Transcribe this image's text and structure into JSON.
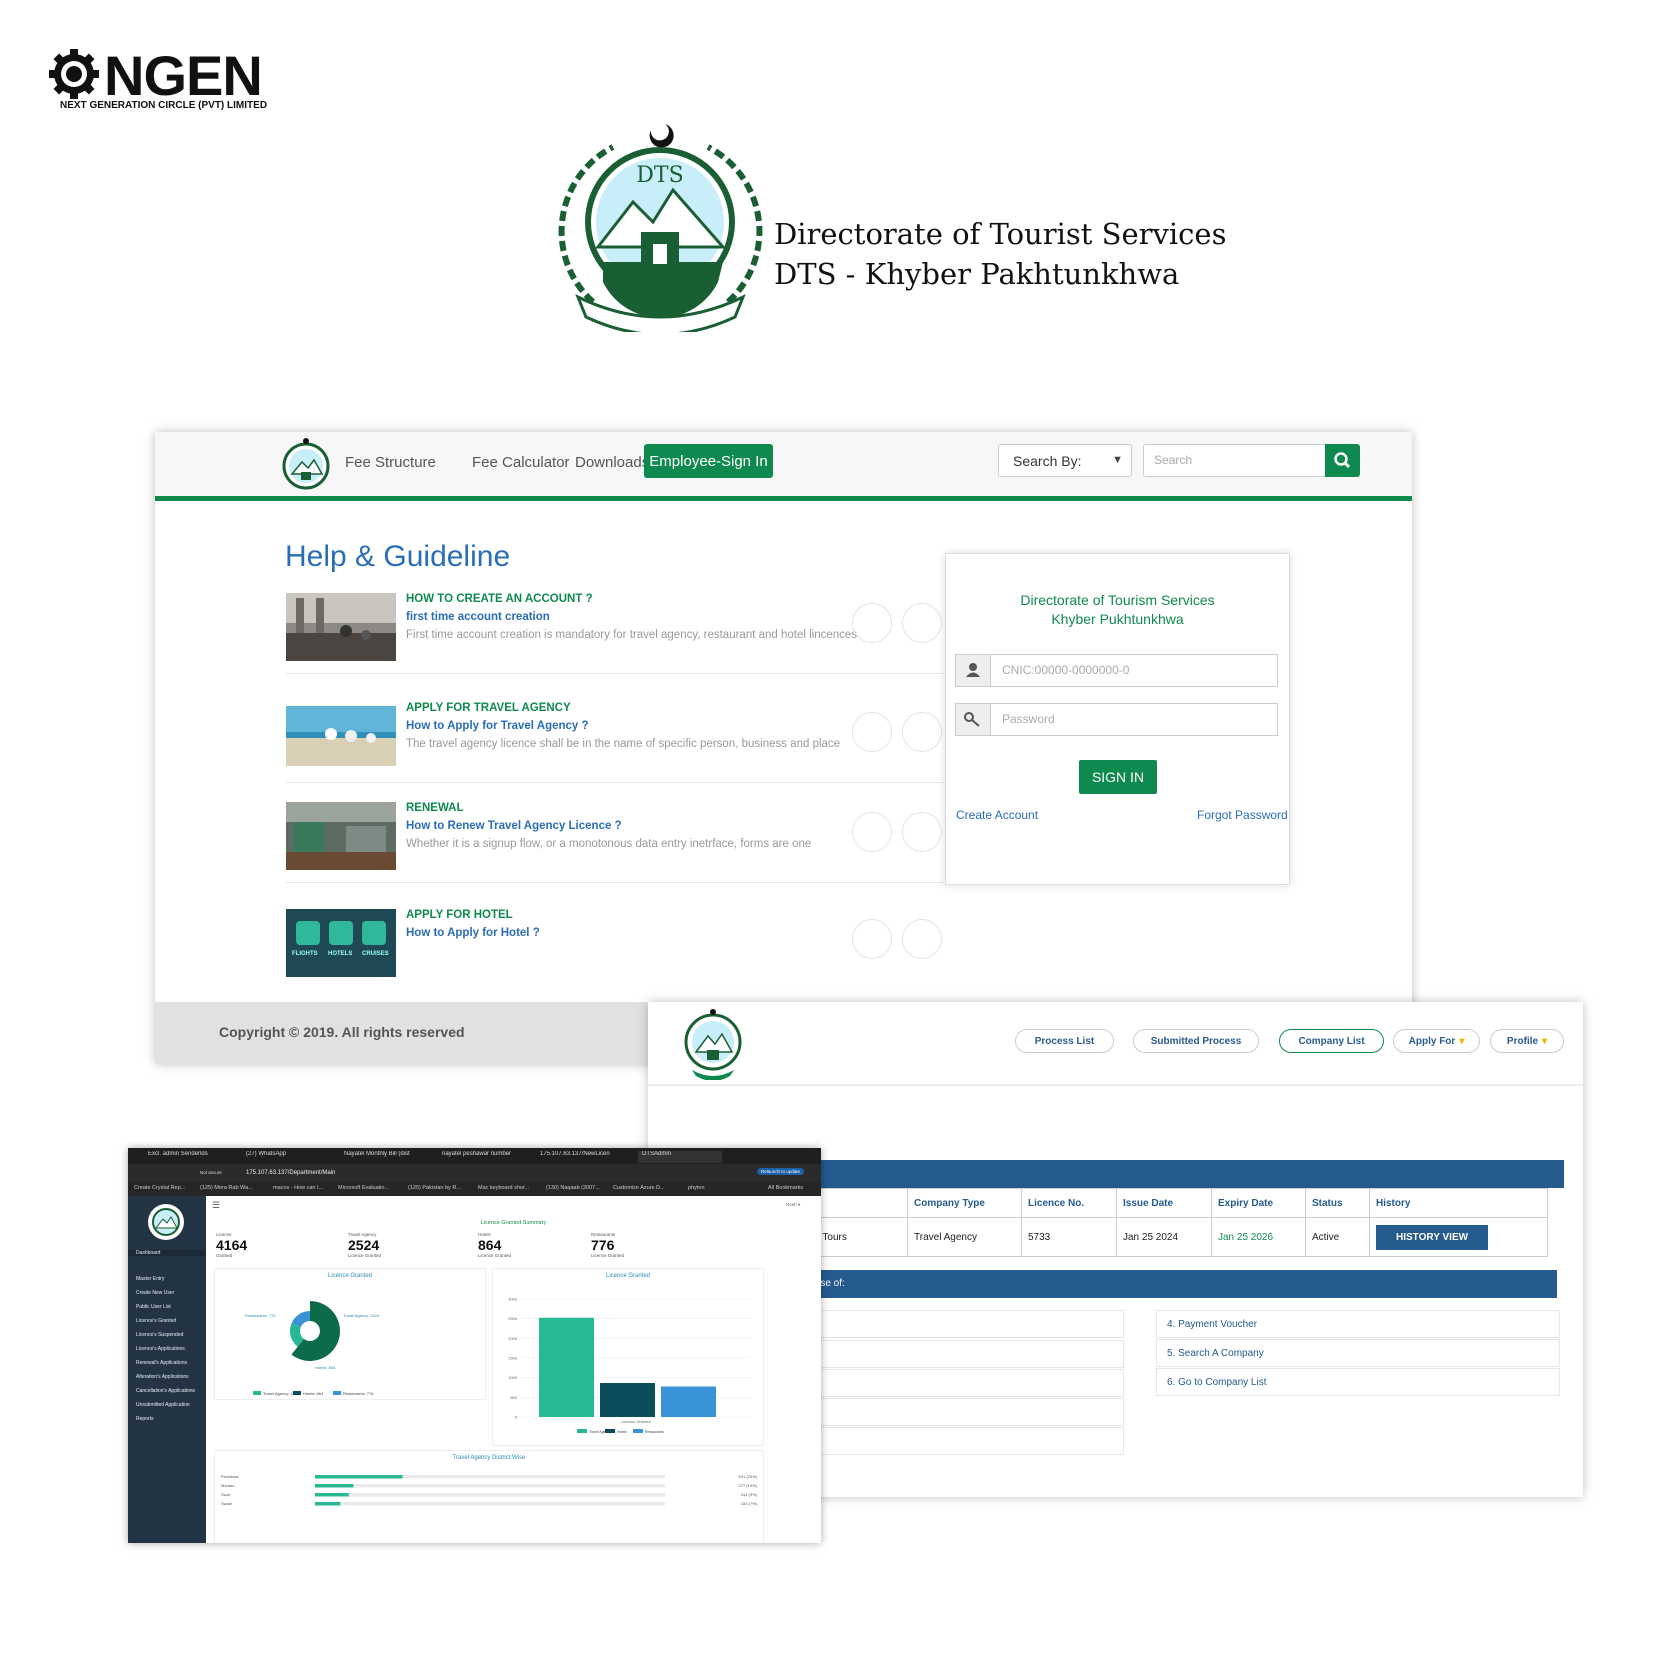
{
  "brand": {
    "name": "NGEN",
    "tagline": "NEXT GENERATION CIRCLE (PVT) LIMITED"
  },
  "dts": {
    "emblem_text": "DTS",
    "line1": "Directorate of Tourist Services",
    "line2": "DTS - Khyber Pakhtunkhwa"
  },
  "login_page": {
    "nav": {
      "links": [
        "Fee Structure",
        "Fee Calculator",
        "Downloads"
      ],
      "employee_sign_in": "Employee-Sign In",
      "search_by": "Search By:",
      "search_placeholder": "Search"
    },
    "help_title": "Help & Guideline",
    "guides": [
      {
        "heading": "HOW TO CREATE AN ACCOUNT ?",
        "subtitle": "first time account creation",
        "description": "First time account creation is mandatory for travel agency, restaurant and hotel lincences"
      },
      {
        "heading": "APPLY FOR TRAVEL AGENCY",
        "subtitle": "How to Apply for Travel Agency ?",
        "description": "The travel agency licence shall be in the name of specific person, business and place"
      },
      {
        "heading": "RENEWAL",
        "subtitle": "How to Renew Travel Agency Licence ?",
        "description": "Whether it is a signup flow, or a monotonous data entry inetrface, forms are one"
      },
      {
        "heading": "APPLY FOR HOTEL",
        "subtitle": "How to Apply for Hotel ?",
        "description": ""
      }
    ],
    "hotel_thumb_labels": [
      "FLIGHTS",
      "HOTELS",
      "CRUISES"
    ],
    "login": {
      "title_line1": "Directorate of Tourism Services",
      "title_line2": "Khyber Pukhtunkhwa",
      "cnic_placeholder": "CNIC:00000-0000000-0",
      "password_placeholder": "Password",
      "sign_in": "SIGN IN",
      "create_account": "Create Account",
      "forgot_password": "Forgot Password"
    },
    "footer": "Copyright © 2019. All rights reserved"
  },
  "company_page": {
    "nav": {
      "process_list": "Process List",
      "submitted_process": "Submitted Process",
      "company_list": "Company List",
      "apply_for": "Apply For",
      "profile": "Profile"
    },
    "table": {
      "headers": [
        "Company Type",
        "Licence No.",
        "Issue Date",
        "Expiry Date",
        "Status",
        "History"
      ],
      "row": {
        "name_partial": "And Tours",
        "company_type": "Travel Agency",
        "licence_no": "5733",
        "issue_date": "Jan 25 2024",
        "expiry_date": "Jan 25 2026",
        "status": "Active",
        "history_button": "HISTORY VIEW"
      }
    },
    "license_bar": "icense of:",
    "license_list": [
      "4. Payment Voucher",
      "5. Search A Company",
      "6. Go to Company List"
    ]
  },
  "dashboard": {
    "browser": {
      "tabs": [
        "Excl. admin Senderlds",
        "(27) WhatsApp",
        "Nayatel Monthly Bill (dist",
        "nayatel peshawar number",
        "175.107.63.137/NewLicen",
        "DTSAdmin"
      ],
      "not_secure": "Not secure",
      "url": "175.107.63.137/Department/Main",
      "relaunch": "Relaunch to update",
      "bookmarks": [
        "Create Crystal Rep...",
        "(125) Mera Rab Wa...",
        "macos - How can I...",
        "Microsoft Evaluatio...",
        "(125) Pakistan by R...",
        "Mac keyboard shor...",
        "(130) Naqaab (2007...",
        "Customize Azure D...",
        "phyton"
      ],
      "all_bookmarks": "All Bookmarks"
    },
    "sidebar": [
      "Dashboard",
      "Master Entry",
      "Create New User",
      "Public User List",
      "Licence's Granted",
      "Licence's Suspended",
      "Licence's Applications",
      "Renewal's Applications",
      "Alteration's Applications",
      "Cancellation's Applications",
      "Unsubmitted Application",
      "Reports"
    ],
    "summary_title": "Licence Granted Summary",
    "kpis": [
      {
        "top": "Licence",
        "value": "4164",
        "bottom": "Granted"
      },
      {
        "top": "Travel Agency",
        "value": "2524",
        "bottom": "Licence Granted"
      },
      {
        "top": "Hotels",
        "value": "864",
        "bottom": "Licence Granted"
      },
      {
        "top": "Restaurants",
        "value": "776",
        "bottom": "Licence Granted"
      }
    ],
    "panel_pie_title": "Licence Granted",
    "panel_bar_title": "Licence Granted",
    "panel_district_title": "Travel Agency District Wise",
    "user_menu": "Noah ▾",
    "colors": {
      "travel": "#27b894",
      "hotels": "#0b4d5c",
      "restaurants": "#3a93d6",
      "pie_dark": "#0e6b4a"
    }
  },
  "chart_data": [
    {
      "type": "pie",
      "title": "Licence Granted",
      "categories": [
        "Travel Agency",
        "Hotels",
        "Restaurants"
      ],
      "values": [
        2524,
        864,
        776
      ],
      "slice_labels": [
        "Travel Agency: 2524",
        "Hotels: 864",
        "Restaurants: 776"
      ],
      "legend": [
        "Travel Agency: 2524",
        "Hotels: 864",
        "Restaurants: 776"
      ]
    },
    {
      "type": "bar",
      "title": "Licence Granted",
      "xlabel": "Licence Granted",
      "categories": [
        "Travel Agency",
        "Hotels",
        "Restaurants"
      ],
      "values": [
        2524,
        864,
        776
      ],
      "ylim": [
        0,
        3000
      ],
      "yticks": [
        "3000",
        "2500",
        "2000",
        "1500",
        "1000",
        "500",
        "0"
      ]
    },
    {
      "type": "bar",
      "title": "Travel Agency District Wise",
      "categories": [
        "Peshawar",
        "Mardan",
        "Swat",
        "Swabi"
      ],
      "values": [
        631,
        277,
        244,
        183
      ],
      "value_labels": [
        "631 (25%)",
        "277 (10%)",
        "244 (9%)",
        "183 (7%)"
      ],
      "xlim": [
        0,
        2524
      ]
    }
  ]
}
